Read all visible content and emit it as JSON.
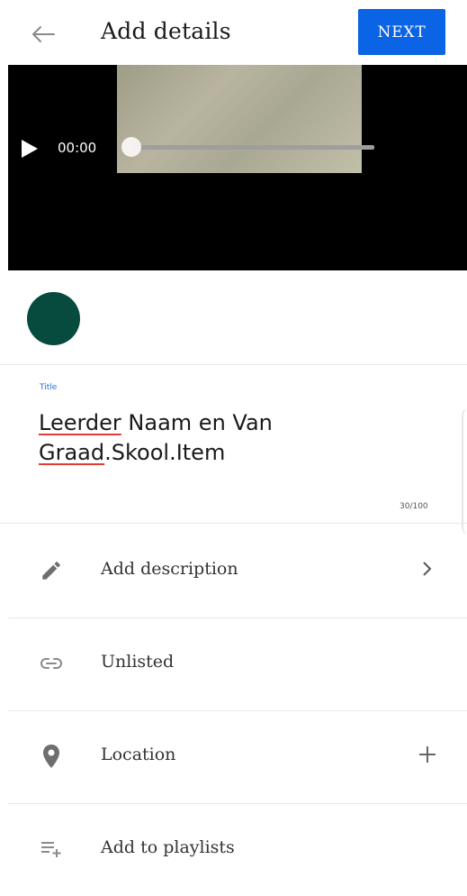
{
  "header": {
    "title": "Add details",
    "next_label": "NEXT",
    "back_icon": "arrow-left-icon",
    "accent_color": "#0b63e5"
  },
  "video": {
    "time": "00:00",
    "progress": 0
  },
  "thumbnail": {
    "color": "#064b3d"
  },
  "title_field": {
    "label": "Title",
    "value_line1_word1": "Leerder",
    "value_line1_rest": " Naam en Van",
    "value_line2_word1": "Graad",
    "value_line2_rest": ".Skool.Item",
    "char_count": "30/100"
  },
  "rows": {
    "description": {
      "label": "Add description",
      "icon": "pencil-icon",
      "trail_icon": "chevron-right-icon"
    },
    "visibility": {
      "label": "Unlisted",
      "icon": "link-icon"
    },
    "location": {
      "label": "Location",
      "icon": "location-pin-icon",
      "trail_icon": "plus-icon"
    },
    "playlists": {
      "label": "Add to playlists",
      "icon": "playlist-add-icon"
    }
  }
}
